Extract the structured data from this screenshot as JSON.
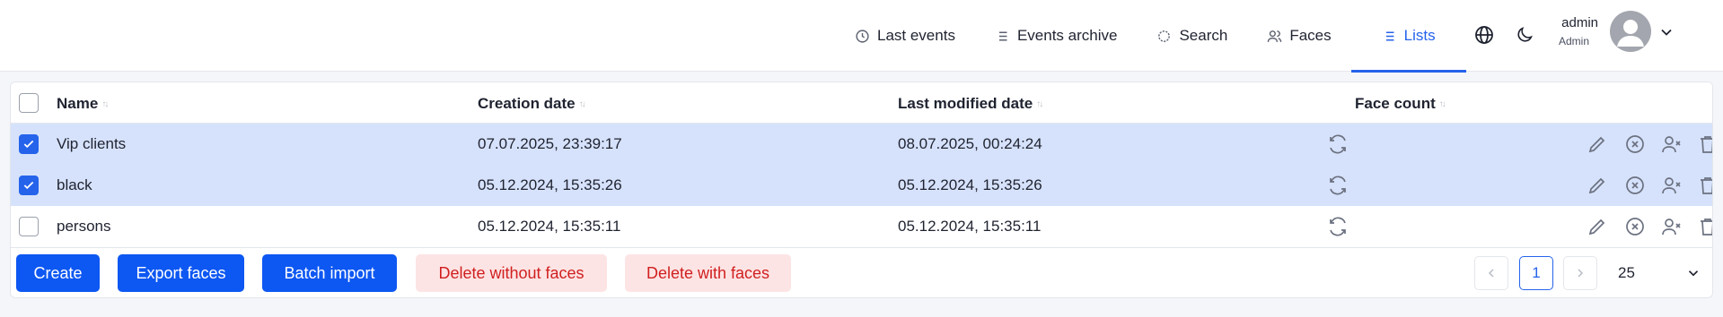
{
  "header": {
    "nav": [
      {
        "label": "Last events",
        "icon": "clock-icon"
      },
      {
        "label": "Events archive",
        "icon": "list-icon"
      },
      {
        "label": "Search",
        "icon": "target-icon"
      },
      {
        "label": "Faces",
        "icon": "users-icon"
      },
      {
        "label": "Lists",
        "icon": "list-icon",
        "active": true
      }
    ],
    "user": {
      "name": "admin",
      "role": "Admin"
    },
    "icons": {
      "language": "globe-icon",
      "theme": "moon-icon"
    }
  },
  "table": {
    "columns": [
      "Name",
      "Creation date",
      "Last modified date",
      "Face count"
    ],
    "rows": [
      {
        "name": "Vip clients",
        "created": "07.07.2025, 23:39:17",
        "modified": "08.07.2025, 00:24:24",
        "checked": true
      },
      {
        "name": "black",
        "created": "05.12.2024, 15:35:26",
        "modified": "05.12.2024, 15:35:26",
        "checked": true
      },
      {
        "name": "persons",
        "created": "05.12.2024, 15:35:11",
        "modified": "05.12.2024, 15:35:11",
        "checked": false
      }
    ]
  },
  "footer": {
    "buttons": {
      "create": "Create",
      "export": "Export faces",
      "batch_import": "Batch import",
      "delete_without": "Delete without faces",
      "delete_with": "Delete with faces"
    },
    "pagination": {
      "current_page": "1",
      "page_size": "25"
    }
  },
  "colors": {
    "accent": "#2563eb",
    "primary_button": "#0d57f2",
    "selected_row": "#d6e2fb",
    "danger_text": "#d11f1f",
    "danger_bg": "#fde4e4"
  }
}
